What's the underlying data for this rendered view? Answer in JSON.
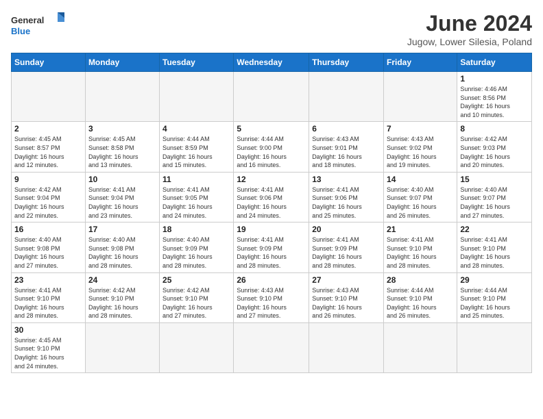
{
  "header": {
    "logo_general": "General",
    "logo_blue": "Blue",
    "month_title": "June 2024",
    "location": "Jugow, Lower Silesia, Poland"
  },
  "weekdays": [
    "Sunday",
    "Monday",
    "Tuesday",
    "Wednesday",
    "Thursday",
    "Friday",
    "Saturday"
  ],
  "days": [
    {
      "date": "",
      "info": ""
    },
    {
      "date": "",
      "info": ""
    },
    {
      "date": "",
      "info": ""
    },
    {
      "date": "",
      "info": ""
    },
    {
      "date": "",
      "info": ""
    },
    {
      "date": "",
      "info": ""
    },
    {
      "date": "1",
      "info": "Sunrise: 4:46 AM\nSunset: 8:56 PM\nDaylight: 16 hours\nand 10 minutes."
    },
    {
      "date": "2",
      "info": "Sunrise: 4:45 AM\nSunset: 8:57 PM\nDaylight: 16 hours\nand 12 minutes."
    },
    {
      "date": "3",
      "info": "Sunrise: 4:45 AM\nSunset: 8:58 PM\nDaylight: 16 hours\nand 13 minutes."
    },
    {
      "date": "4",
      "info": "Sunrise: 4:44 AM\nSunset: 8:59 PM\nDaylight: 16 hours\nand 15 minutes."
    },
    {
      "date": "5",
      "info": "Sunrise: 4:44 AM\nSunset: 9:00 PM\nDaylight: 16 hours\nand 16 minutes."
    },
    {
      "date": "6",
      "info": "Sunrise: 4:43 AM\nSunset: 9:01 PM\nDaylight: 16 hours\nand 18 minutes."
    },
    {
      "date": "7",
      "info": "Sunrise: 4:43 AM\nSunset: 9:02 PM\nDaylight: 16 hours\nand 19 minutes."
    },
    {
      "date": "8",
      "info": "Sunrise: 4:42 AM\nSunset: 9:03 PM\nDaylight: 16 hours\nand 20 minutes."
    },
    {
      "date": "9",
      "info": "Sunrise: 4:42 AM\nSunset: 9:04 PM\nDaylight: 16 hours\nand 22 minutes."
    },
    {
      "date": "10",
      "info": "Sunrise: 4:41 AM\nSunset: 9:04 PM\nDaylight: 16 hours\nand 23 minutes."
    },
    {
      "date": "11",
      "info": "Sunrise: 4:41 AM\nSunset: 9:05 PM\nDaylight: 16 hours\nand 24 minutes."
    },
    {
      "date": "12",
      "info": "Sunrise: 4:41 AM\nSunset: 9:06 PM\nDaylight: 16 hours\nand 24 minutes."
    },
    {
      "date": "13",
      "info": "Sunrise: 4:41 AM\nSunset: 9:06 PM\nDaylight: 16 hours\nand 25 minutes."
    },
    {
      "date": "14",
      "info": "Sunrise: 4:40 AM\nSunset: 9:07 PM\nDaylight: 16 hours\nand 26 minutes."
    },
    {
      "date": "15",
      "info": "Sunrise: 4:40 AM\nSunset: 9:07 PM\nDaylight: 16 hours\nand 27 minutes."
    },
    {
      "date": "16",
      "info": "Sunrise: 4:40 AM\nSunset: 9:08 PM\nDaylight: 16 hours\nand 27 minutes."
    },
    {
      "date": "17",
      "info": "Sunrise: 4:40 AM\nSunset: 9:08 PM\nDaylight: 16 hours\nand 28 minutes."
    },
    {
      "date": "18",
      "info": "Sunrise: 4:40 AM\nSunset: 9:09 PM\nDaylight: 16 hours\nand 28 minutes."
    },
    {
      "date": "19",
      "info": "Sunrise: 4:41 AM\nSunset: 9:09 PM\nDaylight: 16 hours\nand 28 minutes."
    },
    {
      "date": "20",
      "info": "Sunrise: 4:41 AM\nSunset: 9:09 PM\nDaylight: 16 hours\nand 28 minutes."
    },
    {
      "date": "21",
      "info": "Sunrise: 4:41 AM\nSunset: 9:10 PM\nDaylight: 16 hours\nand 28 minutes."
    },
    {
      "date": "22",
      "info": "Sunrise: 4:41 AM\nSunset: 9:10 PM\nDaylight: 16 hours\nand 28 minutes."
    },
    {
      "date": "23",
      "info": "Sunrise: 4:41 AM\nSunset: 9:10 PM\nDaylight: 16 hours\nand 28 minutes."
    },
    {
      "date": "24",
      "info": "Sunrise: 4:42 AM\nSunset: 9:10 PM\nDaylight: 16 hours\nand 28 minutes."
    },
    {
      "date": "25",
      "info": "Sunrise: 4:42 AM\nSunset: 9:10 PM\nDaylight: 16 hours\nand 27 minutes."
    },
    {
      "date": "26",
      "info": "Sunrise: 4:43 AM\nSunset: 9:10 PM\nDaylight: 16 hours\nand 27 minutes."
    },
    {
      "date": "27",
      "info": "Sunrise: 4:43 AM\nSunset: 9:10 PM\nDaylight: 16 hours\nand 26 minutes."
    },
    {
      "date": "28",
      "info": "Sunrise: 4:44 AM\nSunset: 9:10 PM\nDaylight: 16 hours\nand 26 minutes."
    },
    {
      "date": "29",
      "info": "Sunrise: 4:44 AM\nSunset: 9:10 PM\nDaylight: 16 hours\nand 25 minutes."
    },
    {
      "date": "30",
      "info": "Sunrise: 4:45 AM\nSunset: 9:10 PM\nDaylight: 16 hours\nand 24 minutes."
    },
    {
      "date": "",
      "info": ""
    },
    {
      "date": "",
      "info": ""
    },
    {
      "date": "",
      "info": ""
    },
    {
      "date": "",
      "info": ""
    },
    {
      "date": "",
      "info": ""
    },
    {
      "date": "",
      "info": ""
    }
  ]
}
